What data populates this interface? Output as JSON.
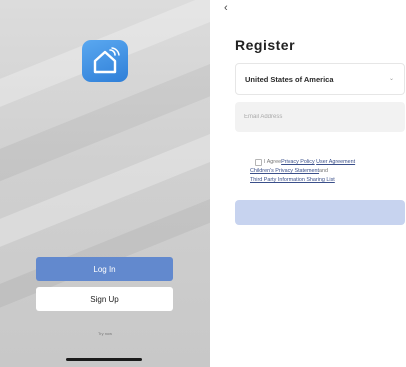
{
  "colors": {
    "login_button": "#6289ce",
    "register_button_disabled": "#c7d3ef",
    "link": "#3a4f8a",
    "app_icon": "#3b8ee0"
  },
  "login_screen": {
    "app_icon": "smart-home-icon",
    "login_label": "Log In",
    "signup_label": "Sign Up",
    "try_now_label": "Try now"
  },
  "register_screen": {
    "back_icon": "chevron-left-icon",
    "title": "Register",
    "country_value": "United States of America",
    "email_placeholder": "Email Address",
    "agree_text": "I Agree",
    "privacy_policy": "Privacy Policy",
    "user_agreement": "User Agreement",
    "childrens_privacy": "Children's Privacy Statement",
    "and_text": "and",
    "third_party": "Third Party Information Sharing List",
    "terms_checked": false
  }
}
